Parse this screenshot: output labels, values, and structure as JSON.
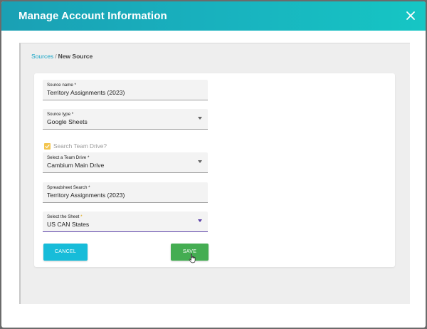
{
  "dialog": {
    "title": "Manage Account Information"
  },
  "breadcrumb": {
    "link": "Sources",
    "separator": "/",
    "current": "New Source"
  },
  "form": {
    "source_name": {
      "label": "Source name",
      "required_mark": "*",
      "value": "Territory Assignments (2023)"
    },
    "source_type": {
      "label": "Source type",
      "required_mark": "*",
      "value": "Google Sheets"
    },
    "search_team_drive": {
      "label": "Search Team Drive?",
      "checked": true
    },
    "team_drive": {
      "label": "Select a Team Drive",
      "required_mark": "*",
      "value": "Cambium Main Drive"
    },
    "spreadsheet_search": {
      "label": "Spreadsheet Search",
      "required_mark": "*",
      "value": "Territory Assignments (2023)"
    },
    "sheet": {
      "label": "Select the Sheet",
      "required_mark": "*",
      "value": "US CAN States"
    }
  },
  "buttons": {
    "cancel": "CANCEL",
    "save": "SAVE"
  },
  "icons": {
    "close": "close-icon",
    "dropdown": "chevron-down-icon",
    "check": "check-icon",
    "cursor": "hand-pointer-icon"
  },
  "colors": {
    "header_start": "#1aa0b4",
    "header_end": "#16c6c4",
    "cancel_button": "#17bcd9",
    "save_button": "#44ad52",
    "checkbox": "#f3c54f",
    "active_underline": "#5a3ea8",
    "link": "#1aa6c7"
  }
}
